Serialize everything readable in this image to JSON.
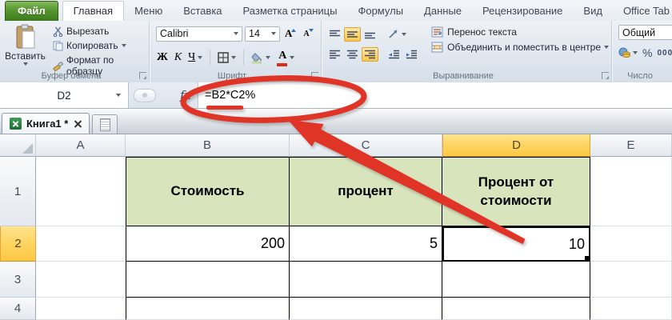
{
  "tabs": [
    {
      "label": "Файл"
    },
    {
      "label": "Главная"
    },
    {
      "label": "Меню"
    },
    {
      "label": "Вставка"
    },
    {
      "label": "Разметка страницы"
    },
    {
      "label": "Формулы"
    },
    {
      "label": "Данные"
    },
    {
      "label": "Рецензирование"
    },
    {
      "label": "Вид"
    },
    {
      "label": "Office Tab"
    }
  ],
  "ribbon": {
    "clipboard": {
      "group_label": "Буфер обмена",
      "paste_label": "Вставить",
      "cut_label": "Вырезать",
      "copy_label": "Копировать",
      "format_painter_label": "Формат по образцу"
    },
    "font": {
      "group_label": "Шрифт",
      "family": "Calibri",
      "size": "14",
      "bold_label": "Ж",
      "italic_label": "К",
      "underline_label": "Ч",
      "grow_label": "А",
      "shrink_label": "А",
      "color_label": "А"
    },
    "alignment": {
      "group_label": "Выравнивание",
      "wrap_label": "Перенос текста",
      "merge_label": "Объединить и поместить в центре"
    },
    "number": {
      "group_label": "Число",
      "format_value": "Общий",
      "percent_label": "%",
      "thousands_label": "000"
    }
  },
  "formula_bar": {
    "name_box_value": "D2",
    "fx_label": "fx",
    "formula": "=B2*C2%"
  },
  "workbook_bar": {
    "active_tab_label": "Книга1 *"
  },
  "sheet": {
    "column_headers": [
      "A",
      "B",
      "C",
      "D",
      "E"
    ],
    "row_headers": [
      "1",
      "2",
      "3",
      "4"
    ],
    "selected_cell": "D2",
    "cells": {
      "b1": "Стоимость",
      "c1": "процент",
      "d1": "Процент от стоимости",
      "b2": "200",
      "c2": "5",
      "d2": "10"
    }
  },
  "annotations": {
    "circled_formula": "=B2*C2%",
    "accent_red": "#e03426"
  },
  "colors": {
    "selection_amber": "#ffd564",
    "header_green": "#d8e4bc",
    "file_tab_green": "#4a8a28"
  }
}
